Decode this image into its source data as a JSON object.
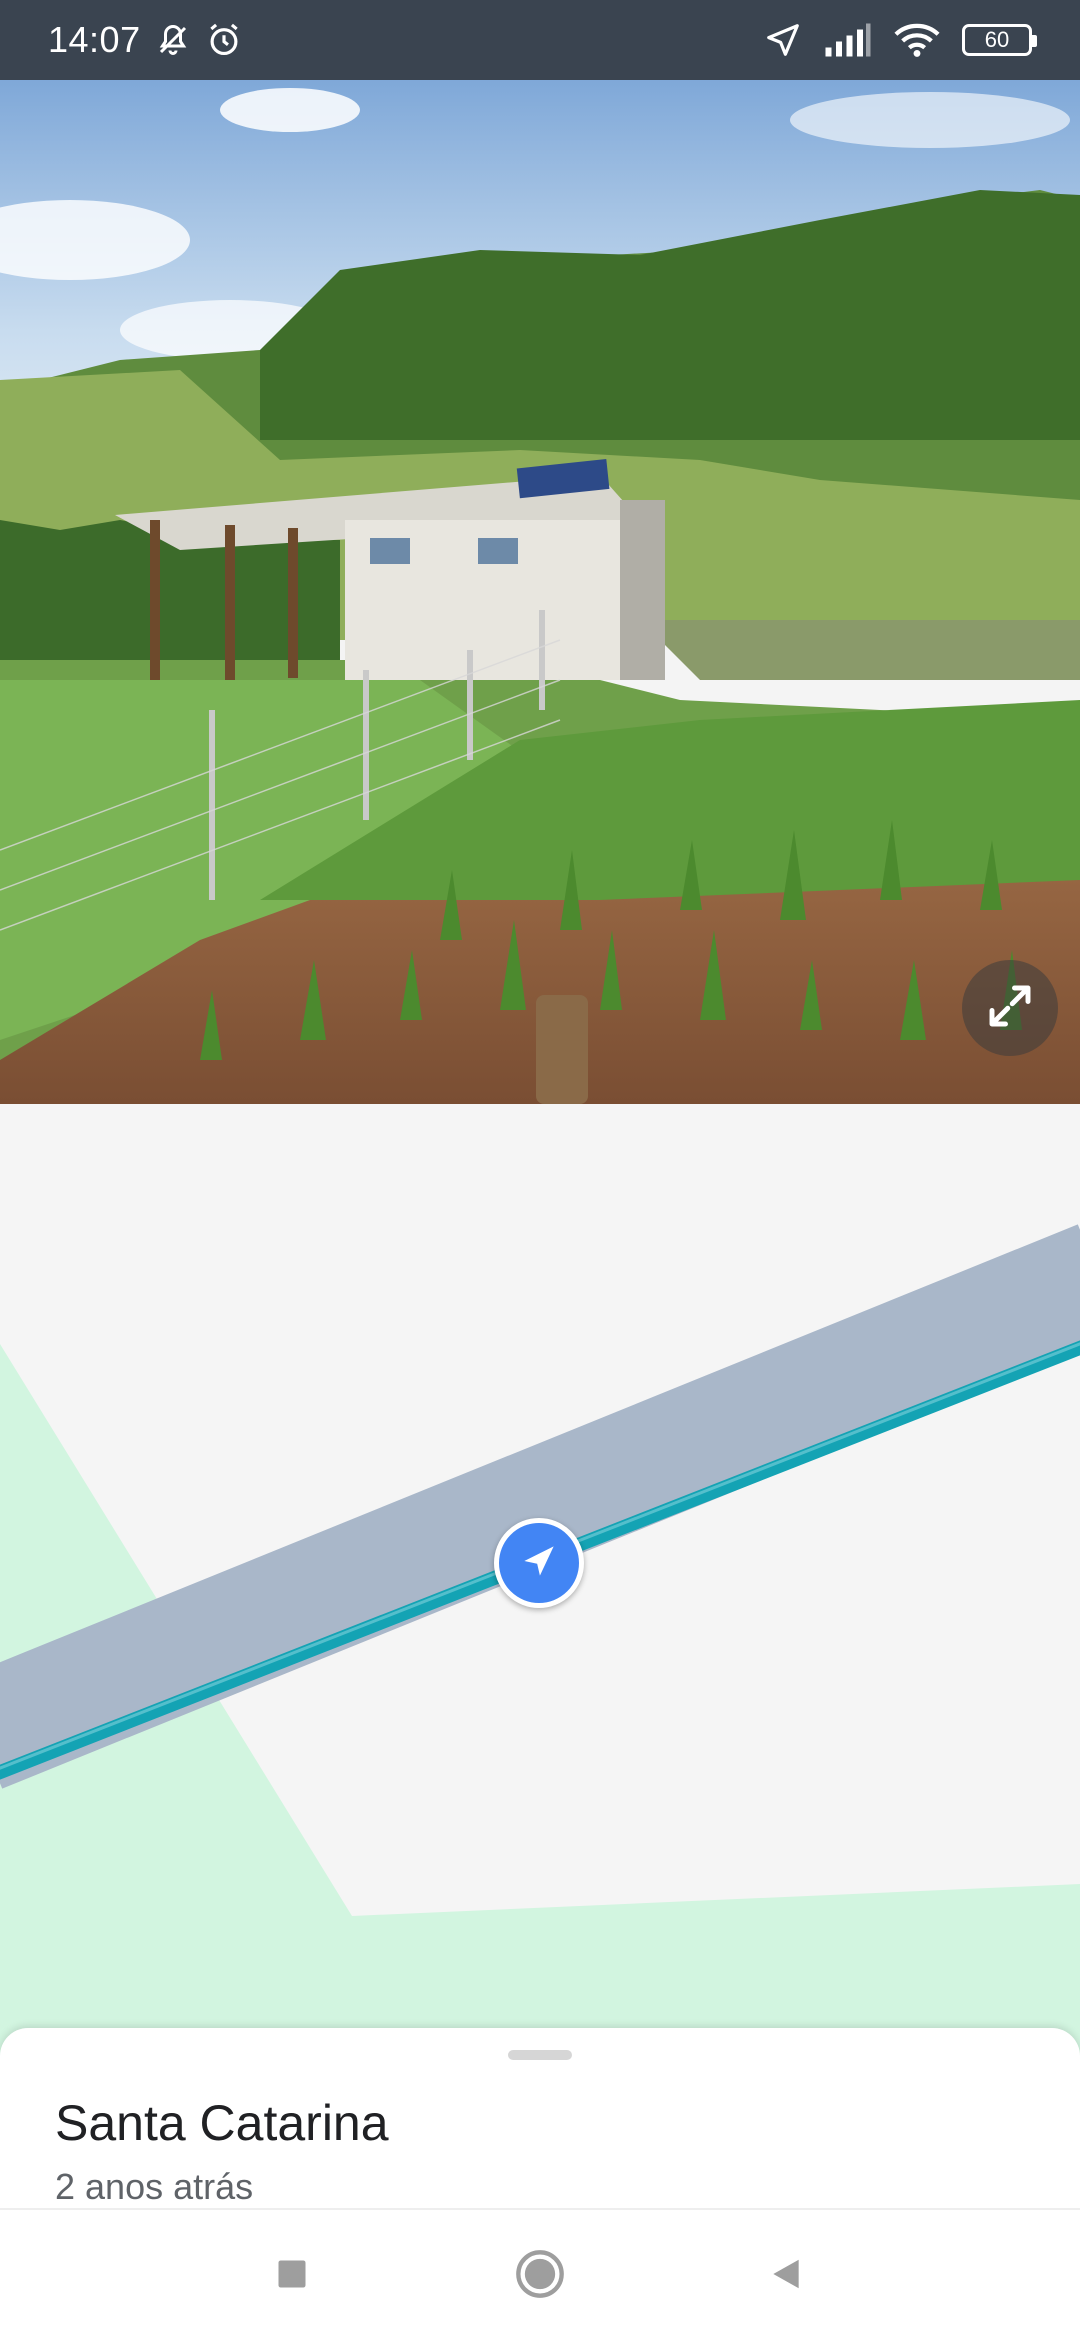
{
  "status_bar": {
    "time": "14:07",
    "battery": "60",
    "icons": [
      "notifications-off-icon",
      "alarm-icon",
      "location-arrow-icon",
      "signal-icon",
      "wifi-icon",
      "battery-icon"
    ]
  },
  "street_view": {
    "expand_icon": "expand-icon"
  },
  "map": {
    "marker_icon": "navigation-arrow-icon",
    "colors": {
      "background": "#f5f5f5",
      "park": "#d2f5e0",
      "road": "#a9b7c9",
      "route": "#14a3b4",
      "marker": "#4285f4"
    }
  },
  "bottom_sheet": {
    "title": "Santa Catarina",
    "subtitle": "2 anos atrás"
  },
  "nav_bar": {
    "icons": [
      "recents-square-icon",
      "home-circle-icon",
      "back-triangle-icon"
    ]
  }
}
